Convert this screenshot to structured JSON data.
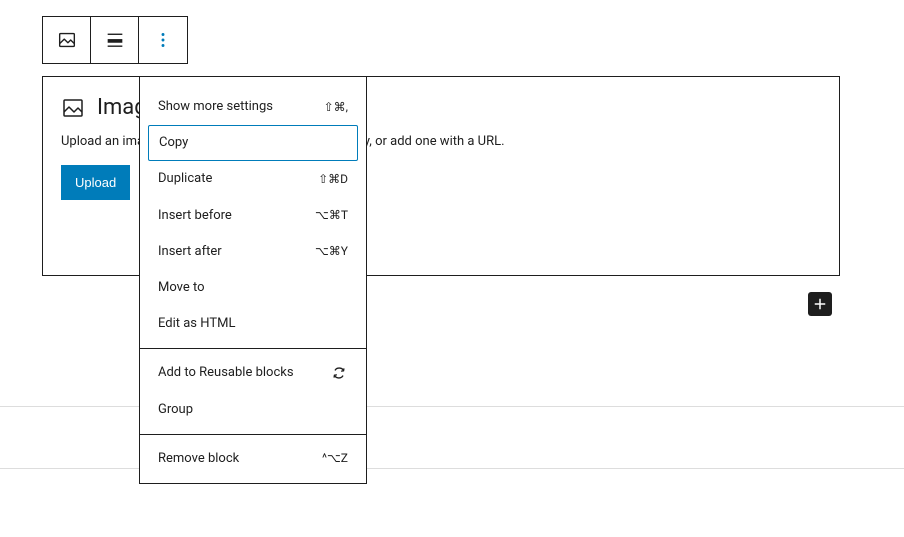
{
  "block": {
    "title": "Image",
    "description": "Upload an image file, pick one from your media library, or add one with a URL.",
    "upload_label": "Upload"
  },
  "menu": {
    "show_more": {
      "label": "Show more settings",
      "shortcut": "⇧⌘,"
    },
    "copy": {
      "label": "Copy"
    },
    "duplicate": {
      "label": "Duplicate",
      "shortcut": "⇧⌘D"
    },
    "insert_before": {
      "label": "Insert before",
      "shortcut": "⌥⌘T"
    },
    "insert_after": {
      "label": "Insert after",
      "shortcut": "⌥⌘Y"
    },
    "move_to": {
      "label": "Move to"
    },
    "edit_html": {
      "label": "Edit as HTML"
    },
    "add_reusable": {
      "label": "Add to Reusable blocks"
    },
    "group": {
      "label": "Group"
    },
    "remove": {
      "label": "Remove block",
      "shortcut": "^⌥Z"
    }
  }
}
